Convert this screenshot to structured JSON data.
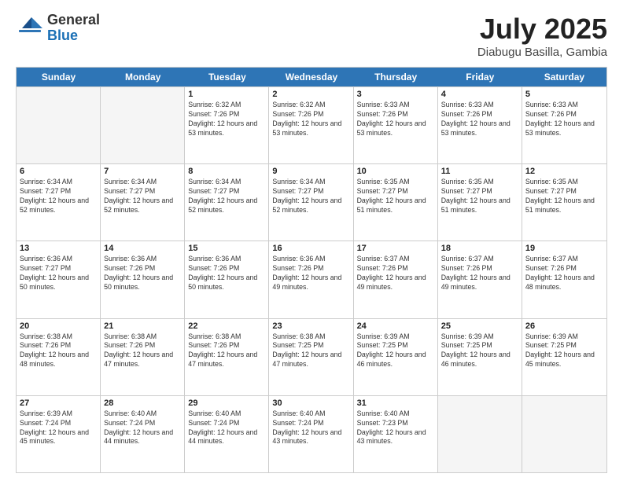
{
  "logo": {
    "general": "General",
    "blue": "Blue"
  },
  "title": {
    "month": "July 2025",
    "location": "Diabugu Basilla, Gambia"
  },
  "header_days": [
    "Sunday",
    "Monday",
    "Tuesday",
    "Wednesday",
    "Thursday",
    "Friday",
    "Saturday"
  ],
  "weeks": [
    [
      {
        "date": "",
        "sunrise": "",
        "sunset": "",
        "daylight": "",
        "empty": true
      },
      {
        "date": "",
        "sunrise": "",
        "sunset": "",
        "daylight": "",
        "empty": true
      },
      {
        "date": "1",
        "sunrise": "Sunrise: 6:32 AM",
        "sunset": "Sunset: 7:26 PM",
        "daylight": "Daylight: 12 hours and 53 minutes.",
        "empty": false
      },
      {
        "date": "2",
        "sunrise": "Sunrise: 6:32 AM",
        "sunset": "Sunset: 7:26 PM",
        "daylight": "Daylight: 12 hours and 53 minutes.",
        "empty": false
      },
      {
        "date": "3",
        "sunrise": "Sunrise: 6:33 AM",
        "sunset": "Sunset: 7:26 PM",
        "daylight": "Daylight: 12 hours and 53 minutes.",
        "empty": false
      },
      {
        "date": "4",
        "sunrise": "Sunrise: 6:33 AM",
        "sunset": "Sunset: 7:26 PM",
        "daylight": "Daylight: 12 hours and 53 minutes.",
        "empty": false
      },
      {
        "date": "5",
        "sunrise": "Sunrise: 6:33 AM",
        "sunset": "Sunset: 7:26 PM",
        "daylight": "Daylight: 12 hours and 53 minutes.",
        "empty": false
      }
    ],
    [
      {
        "date": "6",
        "sunrise": "Sunrise: 6:34 AM",
        "sunset": "Sunset: 7:27 PM",
        "daylight": "Daylight: 12 hours and 52 minutes.",
        "empty": false
      },
      {
        "date": "7",
        "sunrise": "Sunrise: 6:34 AM",
        "sunset": "Sunset: 7:27 PM",
        "daylight": "Daylight: 12 hours and 52 minutes.",
        "empty": false
      },
      {
        "date": "8",
        "sunrise": "Sunrise: 6:34 AM",
        "sunset": "Sunset: 7:27 PM",
        "daylight": "Daylight: 12 hours and 52 minutes.",
        "empty": false
      },
      {
        "date": "9",
        "sunrise": "Sunrise: 6:34 AM",
        "sunset": "Sunset: 7:27 PM",
        "daylight": "Daylight: 12 hours and 52 minutes.",
        "empty": false
      },
      {
        "date": "10",
        "sunrise": "Sunrise: 6:35 AM",
        "sunset": "Sunset: 7:27 PM",
        "daylight": "Daylight: 12 hours and 51 minutes.",
        "empty": false
      },
      {
        "date": "11",
        "sunrise": "Sunrise: 6:35 AM",
        "sunset": "Sunset: 7:27 PM",
        "daylight": "Daylight: 12 hours and 51 minutes.",
        "empty": false
      },
      {
        "date": "12",
        "sunrise": "Sunrise: 6:35 AM",
        "sunset": "Sunset: 7:27 PM",
        "daylight": "Daylight: 12 hours and 51 minutes.",
        "empty": false
      }
    ],
    [
      {
        "date": "13",
        "sunrise": "Sunrise: 6:36 AM",
        "sunset": "Sunset: 7:27 PM",
        "daylight": "Daylight: 12 hours and 50 minutes.",
        "empty": false
      },
      {
        "date": "14",
        "sunrise": "Sunrise: 6:36 AM",
        "sunset": "Sunset: 7:26 PM",
        "daylight": "Daylight: 12 hours and 50 minutes.",
        "empty": false
      },
      {
        "date": "15",
        "sunrise": "Sunrise: 6:36 AM",
        "sunset": "Sunset: 7:26 PM",
        "daylight": "Daylight: 12 hours and 50 minutes.",
        "empty": false
      },
      {
        "date": "16",
        "sunrise": "Sunrise: 6:36 AM",
        "sunset": "Sunset: 7:26 PM",
        "daylight": "Daylight: 12 hours and 49 minutes.",
        "empty": false
      },
      {
        "date": "17",
        "sunrise": "Sunrise: 6:37 AM",
        "sunset": "Sunset: 7:26 PM",
        "daylight": "Daylight: 12 hours and 49 minutes.",
        "empty": false
      },
      {
        "date": "18",
        "sunrise": "Sunrise: 6:37 AM",
        "sunset": "Sunset: 7:26 PM",
        "daylight": "Daylight: 12 hours and 49 minutes.",
        "empty": false
      },
      {
        "date": "19",
        "sunrise": "Sunrise: 6:37 AM",
        "sunset": "Sunset: 7:26 PM",
        "daylight": "Daylight: 12 hours and 48 minutes.",
        "empty": false
      }
    ],
    [
      {
        "date": "20",
        "sunrise": "Sunrise: 6:38 AM",
        "sunset": "Sunset: 7:26 PM",
        "daylight": "Daylight: 12 hours and 48 minutes.",
        "empty": false
      },
      {
        "date": "21",
        "sunrise": "Sunrise: 6:38 AM",
        "sunset": "Sunset: 7:26 PM",
        "daylight": "Daylight: 12 hours and 47 minutes.",
        "empty": false
      },
      {
        "date": "22",
        "sunrise": "Sunrise: 6:38 AM",
        "sunset": "Sunset: 7:26 PM",
        "daylight": "Daylight: 12 hours and 47 minutes.",
        "empty": false
      },
      {
        "date": "23",
        "sunrise": "Sunrise: 6:38 AM",
        "sunset": "Sunset: 7:25 PM",
        "daylight": "Daylight: 12 hours and 47 minutes.",
        "empty": false
      },
      {
        "date": "24",
        "sunrise": "Sunrise: 6:39 AM",
        "sunset": "Sunset: 7:25 PM",
        "daylight": "Daylight: 12 hours and 46 minutes.",
        "empty": false
      },
      {
        "date": "25",
        "sunrise": "Sunrise: 6:39 AM",
        "sunset": "Sunset: 7:25 PM",
        "daylight": "Daylight: 12 hours and 46 minutes.",
        "empty": false
      },
      {
        "date": "26",
        "sunrise": "Sunrise: 6:39 AM",
        "sunset": "Sunset: 7:25 PM",
        "daylight": "Daylight: 12 hours and 45 minutes.",
        "empty": false
      }
    ],
    [
      {
        "date": "27",
        "sunrise": "Sunrise: 6:39 AM",
        "sunset": "Sunset: 7:24 PM",
        "daylight": "Daylight: 12 hours and 45 minutes.",
        "empty": false
      },
      {
        "date": "28",
        "sunrise": "Sunrise: 6:40 AM",
        "sunset": "Sunset: 7:24 PM",
        "daylight": "Daylight: 12 hours and 44 minutes.",
        "empty": false
      },
      {
        "date": "29",
        "sunrise": "Sunrise: 6:40 AM",
        "sunset": "Sunset: 7:24 PM",
        "daylight": "Daylight: 12 hours and 44 minutes.",
        "empty": false
      },
      {
        "date": "30",
        "sunrise": "Sunrise: 6:40 AM",
        "sunset": "Sunset: 7:24 PM",
        "daylight": "Daylight: 12 hours and 43 minutes.",
        "empty": false
      },
      {
        "date": "31",
        "sunrise": "Sunrise: 6:40 AM",
        "sunset": "Sunset: 7:23 PM",
        "daylight": "Daylight: 12 hours and 43 minutes.",
        "empty": false
      },
      {
        "date": "",
        "sunrise": "",
        "sunset": "",
        "daylight": "",
        "empty": true
      },
      {
        "date": "",
        "sunrise": "",
        "sunset": "",
        "daylight": "",
        "empty": true
      }
    ]
  ]
}
